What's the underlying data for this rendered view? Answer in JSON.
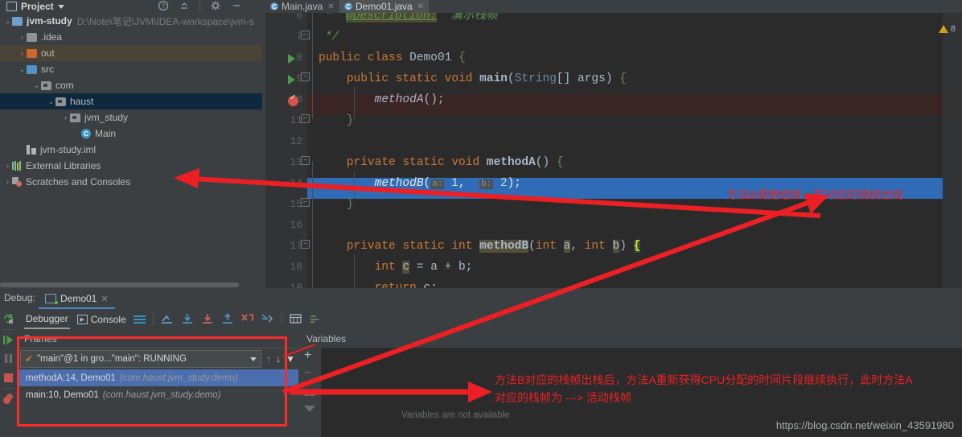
{
  "window": {
    "project_tool_label": "Project",
    "warning_count": "8",
    "watermark_url": "https://blog.csdn.net/weixin_43591980"
  },
  "editor_tabs": [
    {
      "label": "Main.java",
      "active": false,
      "icon": "java-class-icon"
    },
    {
      "label": "Demo01.java",
      "active": true,
      "icon": "java-class-icon"
    }
  ],
  "project_tree": [
    {
      "label": "jvm-study",
      "path": "D:\\Note\\笔记\\JVM\\IDEA-workspace\\jvm-s",
      "indent": 0,
      "expanded": true,
      "icon": "module-folder-icon",
      "state": "normal"
    },
    {
      "label": ".idea",
      "path": "",
      "indent": 1,
      "expanded": false,
      "icon": "folder-icon",
      "state": "normal"
    },
    {
      "label": "out",
      "path": "",
      "indent": 1,
      "expanded": false,
      "icon": "out-folder-icon",
      "state": "highlight"
    },
    {
      "label": "src",
      "path": "",
      "indent": 1,
      "expanded": true,
      "icon": "source-folder-icon",
      "state": "normal"
    },
    {
      "label": "com",
      "path": "",
      "indent": 2,
      "expanded": true,
      "icon": "package-icon",
      "state": "normal"
    },
    {
      "label": "haust",
      "path": "",
      "indent": 3,
      "expanded": true,
      "icon": "package-icon",
      "state": "selected"
    },
    {
      "label": "jvm_study",
      "path": "",
      "indent": 4,
      "expanded": false,
      "icon": "package-icon",
      "state": "normal"
    },
    {
      "label": "Main",
      "path": "",
      "indent": 4,
      "expanded": null,
      "icon": "java-class-icon",
      "state": "normal"
    },
    {
      "label": "jvm-study.iml",
      "path": "",
      "indent": 1,
      "expanded": null,
      "icon": "iml-file-icon",
      "state": "normal"
    },
    {
      "label": "External Libraries",
      "path": "",
      "indent": 0,
      "expanded": false,
      "icon": "libraries-icon",
      "state": "normal"
    },
    {
      "label": "Scratches and Consoles",
      "path": "",
      "indent": 0,
      "expanded": false,
      "icon": "scratches-icon",
      "state": "normal"
    }
  ],
  "code_lines": [
    {
      "number": "6",
      "marker": "",
      "fold": "",
      "state": "normal"
    },
    {
      "number": "7",
      "marker": "",
      "fold": "end",
      "state": "normal"
    },
    {
      "number": "8",
      "marker": "run",
      "fold": "",
      "state": "normal"
    },
    {
      "number": "9",
      "marker": "run",
      "fold": "collapse",
      "state": "normal"
    },
    {
      "number": "10",
      "marker": "breakpoint",
      "fold": "",
      "state": "current"
    },
    {
      "number": "11",
      "marker": "",
      "fold": "end",
      "state": "normal"
    },
    {
      "number": "12",
      "marker": "",
      "fold": "",
      "state": "normal"
    },
    {
      "number": "13",
      "marker": "",
      "fold": "collapse",
      "state": "normal"
    },
    {
      "number": "14",
      "marker": "",
      "fold": "",
      "state": "selected"
    },
    {
      "number": "15",
      "marker": "",
      "fold": "end",
      "state": "normal"
    },
    {
      "number": "16",
      "marker": "",
      "fold": "",
      "state": "normal"
    },
    {
      "number": "17",
      "marker": "",
      "fold": "collapse",
      "state": "normal"
    },
    {
      "number": "18",
      "marker": "",
      "fold": "",
      "state": "normal"
    },
    {
      "number": "19",
      "marker": "",
      "fold": "",
      "state": "normal"
    }
  ],
  "code_text": {
    "l6": "*  @Description: 演示栈帧",
    "l7": "*/",
    "l8": "public class Demo01 {",
    "l9": "public static void main(String[] args) {",
    "l10": "methodA();",
    "l11": "}",
    "l13": "private static void methodA() {",
    "l14": "methodB( a: 1,  b: 2);",
    "l15": "}",
    "l17": "private static int methodB(int a, int b) {",
    "l18": "int c = a + b;",
    "l19": "return c;"
  },
  "debug": {
    "label": "Debug:",
    "session_tab": "Demo01",
    "tabs": [
      {
        "label": "Debugger",
        "selected": true
      },
      {
        "label": "Console",
        "selected": false
      }
    ],
    "frames_header": "Frames",
    "variables_header": "Variables",
    "thread_selector": "\"main\"@1 in gro...\"main\": RUNNING",
    "frames": [
      {
        "label": "methodA:14, Demo01",
        "package": "(com.haust.jvm_study.demo)",
        "selected": true
      },
      {
        "label": "main:10, Demo01",
        "package": "(com.haust.jvm_study.demo)",
        "selected": false
      }
    ],
    "variables_empty_text": "Variables are not available"
  },
  "annotations": [
    {
      "id": "anno-1",
      "text": "方法B调用结束，其对应的栈帧出栈"
    },
    {
      "id": "anno-2-line1",
      "text": "方法B对应的栈帧出栈后，方法A重新获得CPU分配的时间片段继续执行，此时方法A"
    },
    {
      "id": "anno-2-line2",
      "text": "对应的栈帧为 ---> 活动栈帧"
    }
  ],
  "colors": {
    "annotation_red": "#ec2024",
    "selection_blue": "#2f6cb5",
    "frame_selection": "#4b6eaf",
    "tree_selection": "#0d293e",
    "editor_bg": "#2b2b2b",
    "panel_bg": "#3c3f41"
  }
}
